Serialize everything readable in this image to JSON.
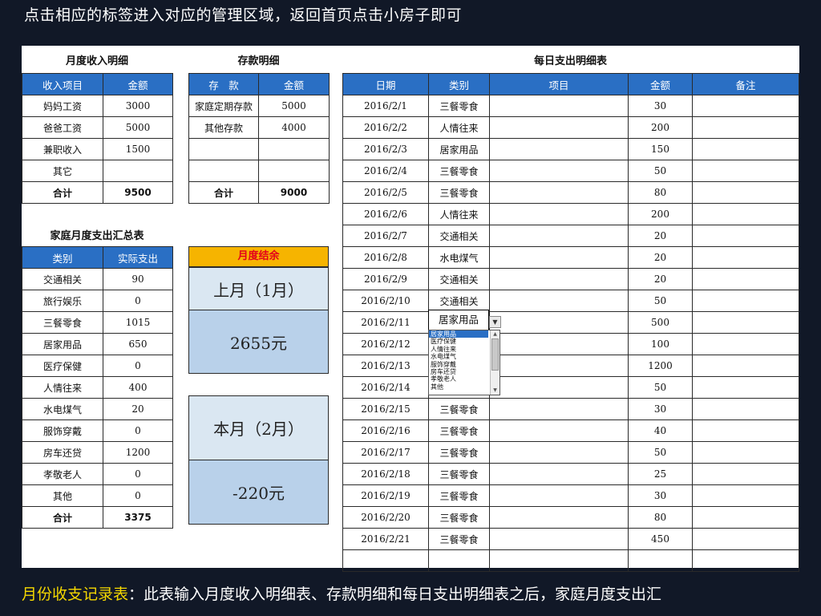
{
  "captions": {
    "top": "点击相应的标签进入对应的管理区域，返回首页点击小房子即可",
    "bottom_highlight": "月份收支记录表",
    "bottom_rest": "：此表输入月度收入明细表、存款明细和每日支出明细表之后，家庭月度支出汇"
  },
  "income": {
    "title": "月度收入明细",
    "headers": [
      "收入项目",
      "金额"
    ],
    "rows": [
      {
        "item": "妈妈工资",
        "amount": "3000"
      },
      {
        "item": "爸爸工资",
        "amount": "5000"
      },
      {
        "item": "兼职收入",
        "amount": "1500"
      },
      {
        "item": "其它",
        "amount": ""
      }
    ],
    "total_label": "合计",
    "total_value": "9500"
  },
  "deposit": {
    "title": "存款明细",
    "headers": [
      "存　款",
      "金额"
    ],
    "rows": [
      {
        "item": "家庭定期存款",
        "amount": "5000"
      },
      {
        "item": "其他存款",
        "amount": "4000"
      },
      {
        "item": "",
        "amount": ""
      },
      {
        "item": "",
        "amount": ""
      }
    ],
    "total_label": "合计",
    "total_value": "9000"
  },
  "summary": {
    "title": "家庭月度支出汇总表",
    "headers": [
      "类别",
      "实际支出"
    ],
    "rows": [
      {
        "cat": "交通相关",
        "amt": "90"
      },
      {
        "cat": "旅行娱乐",
        "amt": "0"
      },
      {
        "cat": "三餐零食",
        "amt": "1015"
      },
      {
        "cat": "居家用品",
        "amt": "650"
      },
      {
        "cat": "医疗保健",
        "amt": "0"
      },
      {
        "cat": "人情往来",
        "amt": "400"
      },
      {
        "cat": "水电煤气",
        "amt": "20"
      },
      {
        "cat": "服饰穿戴",
        "amt": "0"
      },
      {
        "cat": "房车还贷",
        "amt": "1200"
      },
      {
        "cat": "孝敬老人",
        "amt": "0"
      },
      {
        "cat": "其他",
        "amt": "0"
      }
    ],
    "total_label": "合计",
    "total_value": "3375"
  },
  "balance": {
    "header": "月度结余",
    "last_label": "上月（1月）",
    "last_value": "2655元",
    "this_label": "本月（2月）",
    "this_value": "-220元"
  },
  "daily": {
    "title": "每日支出明细表",
    "headers": [
      "日期",
      "类别",
      "项目",
      "金额",
      "备注"
    ],
    "rows": [
      {
        "date": "2016/2/1",
        "cat": "三餐零食",
        "item": "",
        "amt": "30",
        "note": ""
      },
      {
        "date": "2016/2/2",
        "cat": "人情往来",
        "item": "",
        "amt": "200",
        "note": ""
      },
      {
        "date": "2016/2/3",
        "cat": "居家用品",
        "item": "",
        "amt": "150",
        "note": ""
      },
      {
        "date": "2016/2/4",
        "cat": "三餐零食",
        "item": "",
        "amt": "50",
        "note": ""
      },
      {
        "date": "2016/2/5",
        "cat": "三餐零食",
        "item": "",
        "amt": "80",
        "note": ""
      },
      {
        "date": "2016/2/6",
        "cat": "人情往来",
        "item": "",
        "amt": "200",
        "note": ""
      },
      {
        "date": "2016/2/7",
        "cat": "交通相关",
        "item": "",
        "amt": "20",
        "note": ""
      },
      {
        "date": "2016/2/8",
        "cat": "水电煤气",
        "item": "",
        "amt": "20",
        "note": ""
      },
      {
        "date": "2016/2/9",
        "cat": "交通相关",
        "item": "",
        "amt": "20",
        "note": ""
      },
      {
        "date": "2016/2/10",
        "cat": "交通相关",
        "item": "",
        "amt": "50",
        "note": ""
      },
      {
        "date": "2016/2/11",
        "cat": "居家用品",
        "item": "",
        "amt": "500",
        "note": ""
      },
      {
        "date": "2016/2/12",
        "cat": "",
        "item": "",
        "amt": "100",
        "note": ""
      },
      {
        "date": "2016/2/13",
        "cat": "",
        "item": "",
        "amt": "1200",
        "note": ""
      },
      {
        "date": "2016/2/14",
        "cat": "",
        "item": "",
        "amt": "50",
        "note": ""
      },
      {
        "date": "2016/2/15",
        "cat": "三餐零食",
        "item": "",
        "amt": "30",
        "note": ""
      },
      {
        "date": "2016/2/16",
        "cat": "三餐零食",
        "item": "",
        "amt": "40",
        "note": ""
      },
      {
        "date": "2016/2/17",
        "cat": "三餐零食",
        "item": "",
        "amt": "50",
        "note": ""
      },
      {
        "date": "2016/2/18",
        "cat": "三餐零食",
        "item": "",
        "amt": "25",
        "note": ""
      },
      {
        "date": "2016/2/19",
        "cat": "三餐零食",
        "item": "",
        "amt": "30",
        "note": ""
      },
      {
        "date": "2016/2/20",
        "cat": "三餐零食",
        "item": "",
        "amt": "80",
        "note": ""
      },
      {
        "date": "2016/2/21",
        "cat": "三餐零食",
        "item": "",
        "amt": "450",
        "note": ""
      },
      {
        "date": "",
        "cat": "",
        "item": "",
        "amt": "",
        "note": ""
      }
    ],
    "dropdown": {
      "current": "居家用品",
      "options": [
        "居家用品",
        "医疗保健",
        "人情往来",
        "水电煤气",
        "服饰穿戴",
        "房车还贷",
        "孝敬老人",
        "其他"
      ]
    }
  }
}
